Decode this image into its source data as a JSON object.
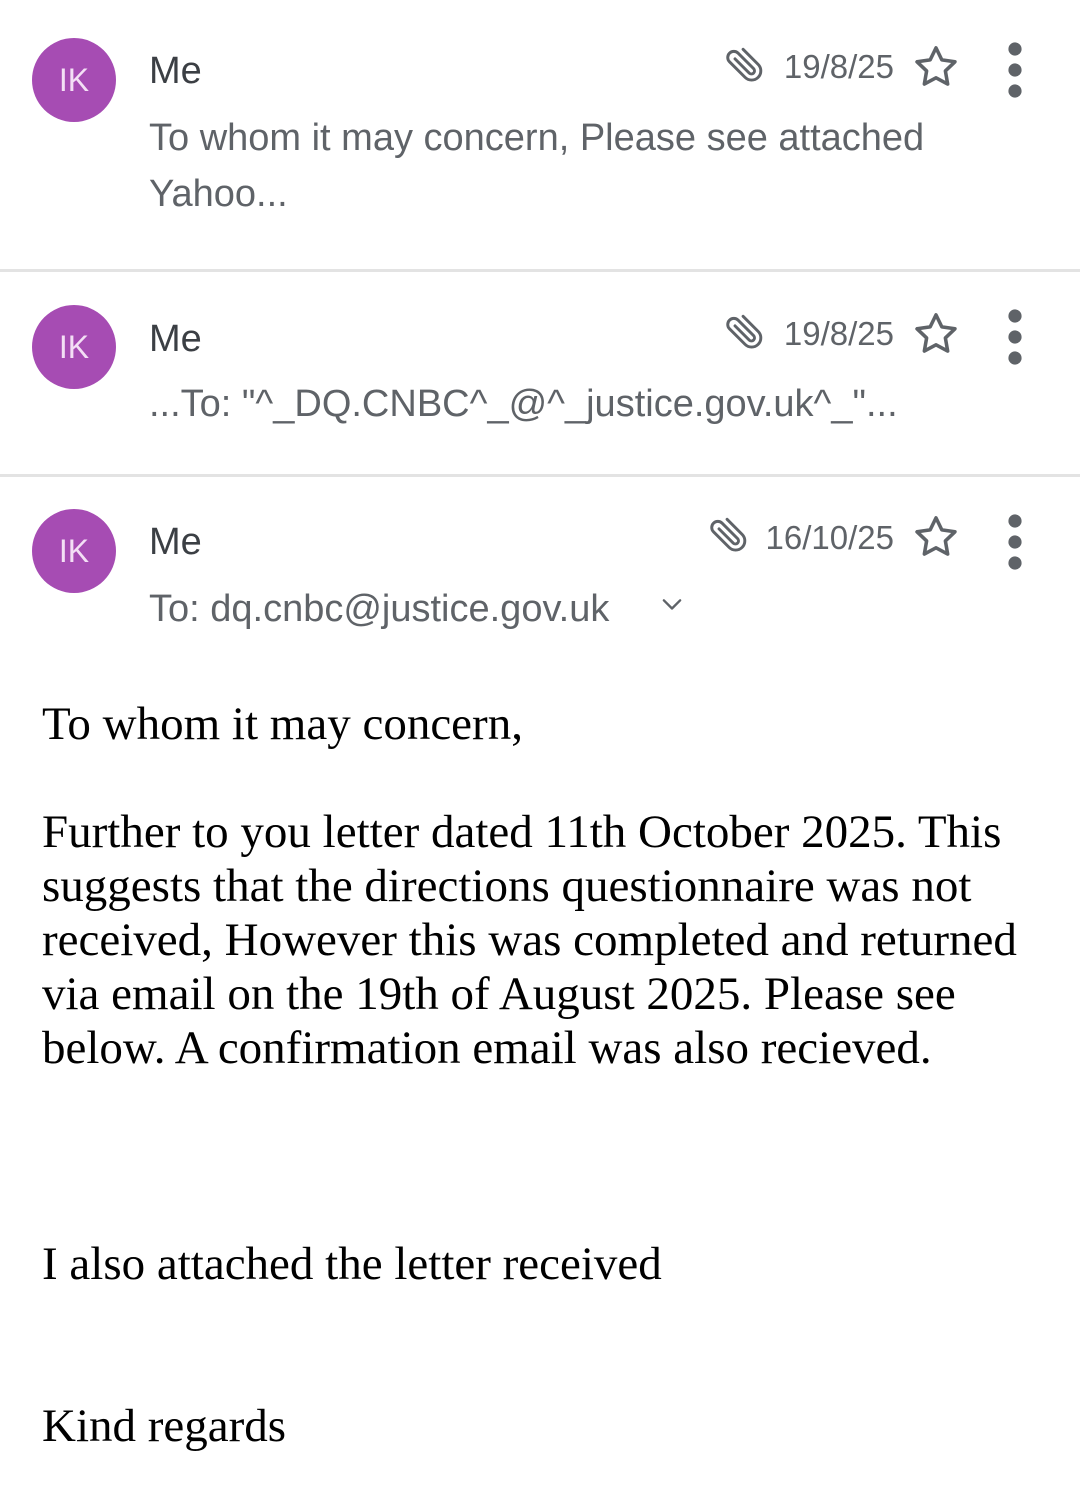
{
  "messages": [
    {
      "avatar": "IK",
      "sender": "Me",
      "date": "19/8/25",
      "snippet": "To whom it may concern, Please see attached Yahoo...",
      "has_attachment": true,
      "attachment_icon": "paperclip-icon",
      "star_icon": "star-outline-icon",
      "more_icon": "more-vertical-icon"
    },
    {
      "avatar": "IK",
      "sender": "Me",
      "date": "19/8/25",
      "snippet": "...To: \"^_DQ.CNBC^_@^_justice.gov.uk^_\"...",
      "has_attachment": true,
      "attachment_icon": "paperclip-icon",
      "star_icon": "star-outline-icon",
      "more_icon": "more-vertical-icon"
    },
    {
      "avatar": "IK",
      "sender": "Me",
      "date": "16/10/25",
      "recipients": "To: dq.cnbc@justice.gov.uk",
      "has_attachment": true,
      "attachment_icon": "paperclip-icon",
      "star_icon": "star-outline-icon",
      "more_icon": "more-vertical-icon",
      "expand_icon": "chevron-down-icon",
      "body": {
        "greeting": "To whom it may concern,",
        "paragraph": "Further to you letter dated 11th October 2025. This suggests that the directions questionnaire was not received, However this was completed and returned via email on the 19th of August 2025. Please see below. A confirmation email was also recieved.",
        "attachment_note": "I also attached the letter received",
        "signoff": "Kind regards"
      }
    }
  ],
  "colors": {
    "avatar_bg": "#a64cb3",
    "avatar_text": "#f3dff5",
    "secondary_text": "#5f6368",
    "divider": "#e3e3e3"
  }
}
